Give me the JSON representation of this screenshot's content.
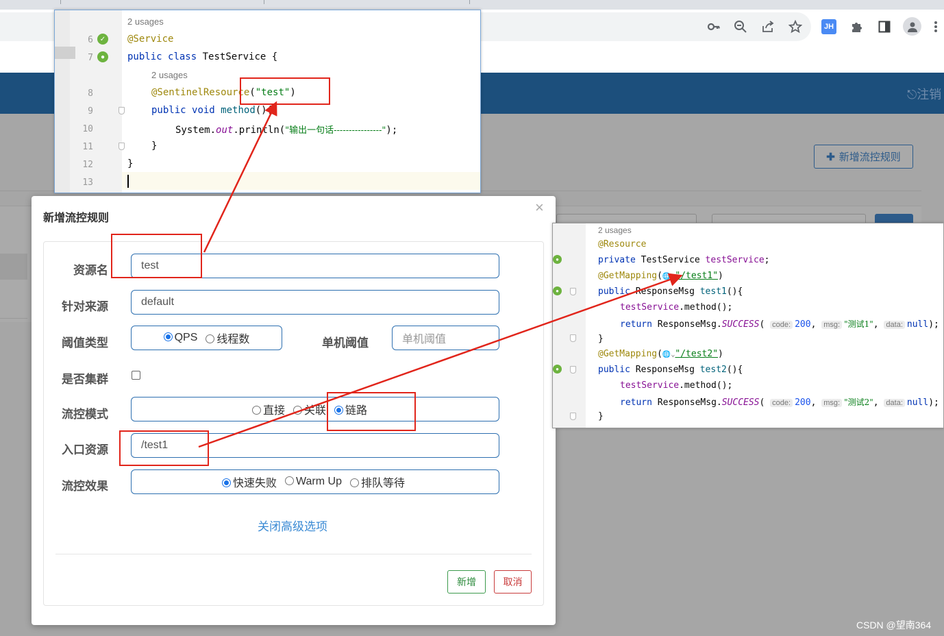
{
  "browser": {
    "icons": [
      "key-icon",
      "zoom-icon",
      "share-icon",
      "star-icon",
      "jh-extension-icon",
      "puzzle-icon",
      "sidepanel-icon",
      "profile-icon",
      "more-icon"
    ],
    "extension_label": "JH"
  },
  "app": {
    "logout_label": "注销",
    "add_rule_button": "新增流控规则"
  },
  "ide_service": {
    "lines": [
      {
        "num": "",
        "usages": "2 usages"
      },
      {
        "num": "6"
      },
      {
        "num": "7"
      },
      {
        "num": "",
        "usages": "2 usages"
      },
      {
        "num": "8"
      },
      {
        "num": "9"
      },
      {
        "num": "10"
      },
      {
        "num": "11"
      },
      {
        "num": "12"
      },
      {
        "num": "13"
      }
    ],
    "annotation_service": "@Service",
    "kw_public": "public",
    "kw_class": "class",
    "class_name": "TestService {",
    "annotation_sentinel": "@SentinelResource",
    "resource_arg_open": "(",
    "resource_string": "\"test\"",
    "resource_arg_close": ")",
    "kw_void": "void",
    "method_name": "method",
    "method_tail": "(){",
    "println_prefix": "System.",
    "println_out": "out",
    "println_call": ".println(",
    "println_string": "\"输出一句话----------------\"",
    "println_end": ");",
    "close_brace_inner": "}",
    "close_brace_outer": "}"
  },
  "modal": {
    "title": "新增流控规则",
    "close": "×",
    "labels": {
      "resource": "资源名",
      "origin": "针对来源",
      "threshold_type": "阈值类型",
      "single_threshold": "单机阈值",
      "cluster": "是否集群",
      "mode": "流控模式",
      "entry": "入口资源",
      "effect": "流控效果"
    },
    "values": {
      "resource": "test",
      "origin": "default",
      "single_threshold_placeholder": "单机阈值",
      "entry": "/test1"
    },
    "threshold_options": [
      "QPS",
      "线程数"
    ],
    "mode_options": [
      "直接",
      "关联",
      "链路"
    ],
    "effect_options": [
      "快速失败",
      "Warm Up",
      "排队等待"
    ],
    "advanced_link": "关闭高级选项",
    "save_button": "新增",
    "cancel_button": "取消"
  },
  "ide_controller": {
    "usages": "2 usages",
    "annotation_resource": "@Resource",
    "kw_private": "private",
    "field_type": "TestService",
    "field_name": "testService",
    "semicolon": ";",
    "annotation_getmapping": "@GetMapping",
    "mapping_open": "(",
    "globe_hint": "🌐⌄",
    "path1": "\"/test1\"",
    "path2": "\"/test2\"",
    "mapping_close": ")",
    "kw_public": "public",
    "return_type": "ResponseMsg",
    "method1": "test1",
    "method2": "test2",
    "method_tail": "(){",
    "call_obj": "testService",
    "call_method": ".method();",
    "kw_return": "return",
    "ret_class": "ResponseMsg.",
    "ret_const": "SUCCESS",
    "ret_open": "(",
    "hint_code": "code:",
    "code_value": "200",
    "comma": ",",
    "hint_msg": "msg:",
    "msg1": "\"测试1\"",
    "msg2": "\"测试2\"",
    "hint_data": "data:",
    "kw_null": "null",
    "ret_end": ");",
    "close_brace": "}"
  },
  "colors": {
    "annotation_red": "#e1251b",
    "app_header": "#1c4f7c",
    "accent_blue": "#2d6fb0"
  },
  "watermark": "CSDN @望南364"
}
